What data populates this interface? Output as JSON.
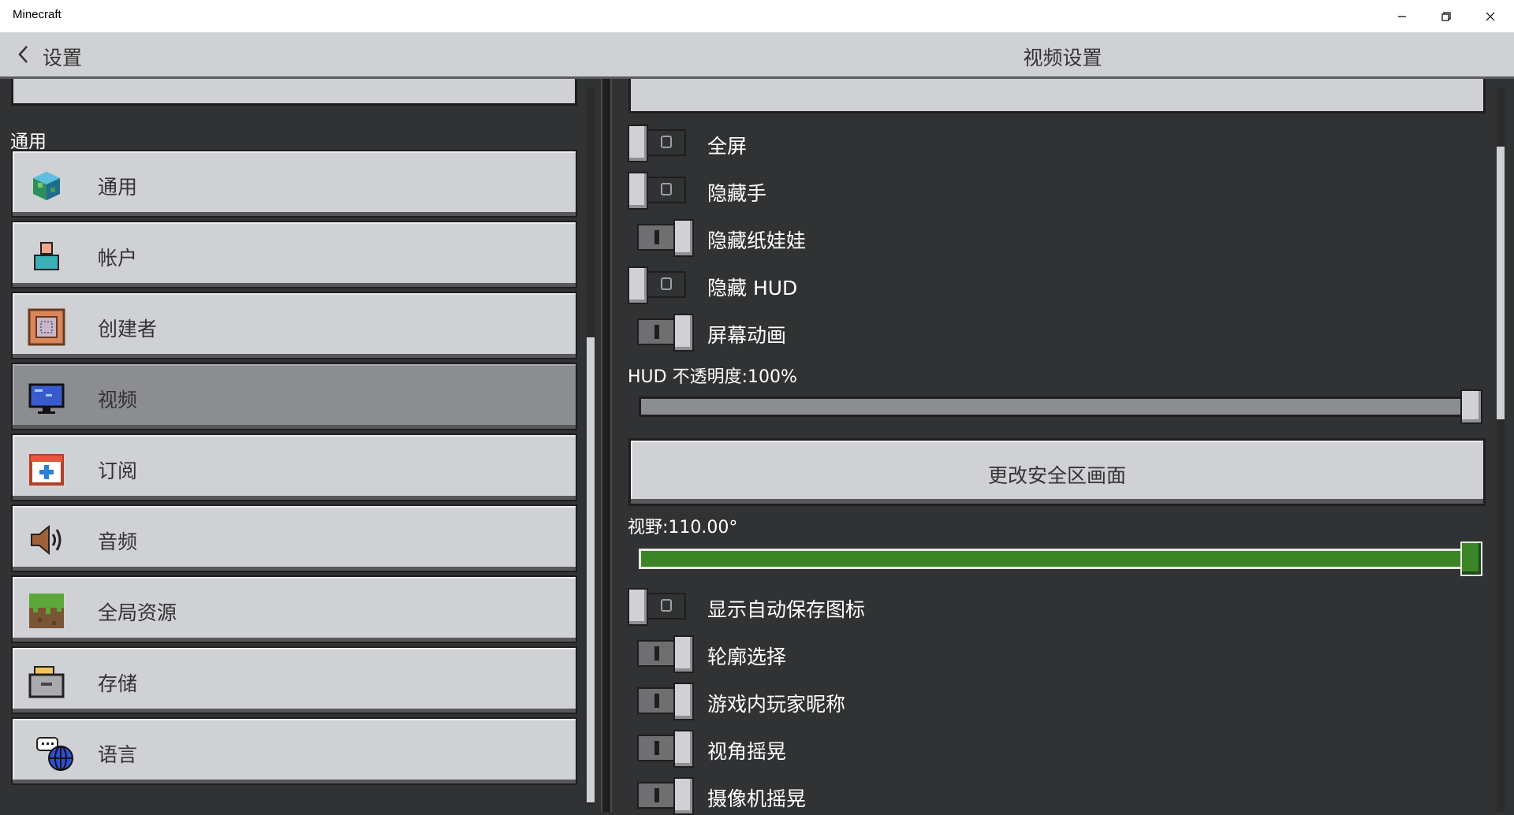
{
  "window": {
    "title": "Minecraft",
    "controls": [
      "minimize-icon",
      "restore-icon",
      "close-icon"
    ]
  },
  "header": {
    "back_label": "设置",
    "page_title": "视频设置"
  },
  "sidebar": {
    "section_label": "通用",
    "items": [
      {
        "label": "通用",
        "icon": "globe-block-icon",
        "selected": false
      },
      {
        "label": "帐户",
        "icon": "account-person-icon",
        "selected": false
      },
      {
        "label": "创建者",
        "icon": "command-block-icon",
        "selected": false
      },
      {
        "label": "视频",
        "icon": "monitor-icon",
        "selected": true
      },
      {
        "label": "订阅",
        "icon": "calendar-plus-icon",
        "selected": false
      },
      {
        "label": "音频",
        "icon": "speaker-icon",
        "selected": false
      },
      {
        "label": "全局资源",
        "icon": "grass-block-icon",
        "selected": false
      },
      {
        "label": "存储",
        "icon": "storage-box-icon",
        "selected": false
      },
      {
        "label": "语言",
        "icon": "language-globe-icon",
        "selected": false
      }
    ]
  },
  "settings": {
    "toggles_top": [
      {
        "label": "全屏",
        "on": false
      },
      {
        "label": "隐藏手",
        "on": false
      },
      {
        "label": "隐藏纸娃娃",
        "on": true
      },
      {
        "label": "隐藏 HUD",
        "on": false
      },
      {
        "label": "屏幕动画",
        "on": true
      }
    ],
    "hud_opacity": {
      "label": "HUD 不透明度:100%",
      "value_percent": 100
    },
    "safe_area_button": "更改安全区画面",
    "fov": {
      "label": "视野:110.00°",
      "value": 110.0,
      "fraction": 1.0
    },
    "toggles_bottom": [
      {
        "label": "显示自动保存图标",
        "on": false
      },
      {
        "label": "轮廓选择",
        "on": true
      },
      {
        "label": "游戏内玩家昵称",
        "on": true
      },
      {
        "label": "视角摇晃",
        "on": true
      },
      {
        "label": "摄像机摇晃",
        "on": true
      }
    ]
  },
  "colors": {
    "panel_bg": "#313233",
    "button_bg": "#d0d1d4",
    "selected_bg": "#8c8d90",
    "fov_green": "#3c8527"
  }
}
